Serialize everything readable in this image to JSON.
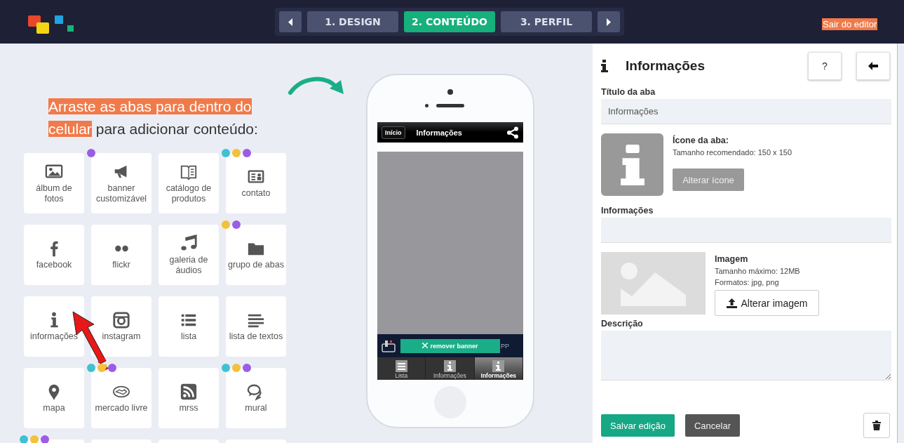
{
  "topbar": {
    "steps": [
      {
        "label": "1. DESIGN",
        "selected": false
      },
      {
        "label": "2. CONTEÚDO",
        "selected": true
      },
      {
        "label": "3. PERFIL",
        "selected": false
      }
    ],
    "exit_link": "Sair do editor"
  },
  "instructions": {
    "highlighted": "Arraste as abas para dentro do celular",
    "rest": "para adicionar conteúdo:"
  },
  "tiles": [
    {
      "label": "álbum de fotos"
    },
    {
      "label": "banner customizável",
      "dots": [
        {
          "color": "#9b5de5"
        }
      ]
    },
    {
      "label": "catálogo de produtos"
    },
    {
      "label": "contato",
      "dots": [
        {
          "color": "#3ec1d3"
        },
        {
          "color": "#f3c13a"
        },
        {
          "color": "#9b5de5"
        }
      ]
    },
    {
      "label": "facebook"
    },
    {
      "label": "flickr"
    },
    {
      "label": "galeria de áudios"
    },
    {
      "label": "grupo de abas",
      "dots": [
        {
          "color": "#f3c13a"
        },
        {
          "color": "#9b5de5"
        }
      ]
    },
    {
      "label": "informações"
    },
    {
      "label": "instagram"
    },
    {
      "label": "lista"
    },
    {
      "label": "lista de textos"
    },
    {
      "label": "mapa"
    },
    {
      "label": "mercado livre",
      "dots": [
        {
          "color": "#3ec1d3"
        },
        {
          "color": "#f3c13a"
        },
        {
          "color": "#9b5de5"
        }
      ]
    },
    {
      "label": "mrss"
    },
    {
      "label": "mural",
      "dots": [
        {
          "color": "#3ec1d3"
        },
        {
          "color": "#f3c13a"
        },
        {
          "color": "#9b5de5"
        }
      ]
    },
    {
      "kind": "empty",
      "dots": [
        {
          "color": "#3ec1d3"
        },
        {
          "color": "#f3c13a"
        },
        {
          "color": "#9b5de5"
        }
      ]
    },
    {
      "kind": "empty"
    },
    {
      "kind": "empty"
    },
    {
      "kind": "empty"
    }
  ],
  "phone": {
    "back": "Início",
    "title": "Informações",
    "remove_banner": "remover banner",
    "banner_text": "PP",
    "tabs": [
      {
        "label": "Lista",
        "selected": false
      },
      {
        "label": "Informações",
        "selected": false
      },
      {
        "label": "Informações",
        "selected": true
      }
    ]
  },
  "panel": {
    "title": "Informações",
    "help": "?",
    "tab_title_label": "Título da aba",
    "tab_title_value": "Informações",
    "icon_label": "Ícone da aba:",
    "icon_hint": "Tamanho recomendado: 150 x 150",
    "change_icon": "Alterar ícone",
    "info_label": "Informações",
    "image_label": "Imagem",
    "image_max": "Tamanho máximo: 12MB",
    "image_formats": "Formatos: jpg, png",
    "change_image": "Alterar imagem",
    "description_label": "Descrição",
    "save": "Salvar edição",
    "cancel": "Cancelar"
  }
}
